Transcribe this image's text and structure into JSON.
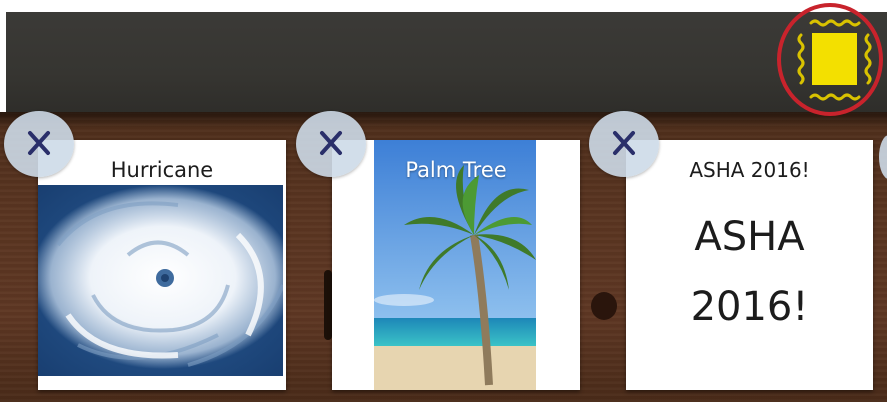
{
  "toolbar": {
    "mode_button_icon": "yellow-square-icon",
    "mode_button_highlight_color": "#c8232c",
    "mode_button_color": "#f3e000"
  },
  "cards": [
    {
      "label": "Hurricane",
      "image": "hurricane-satellite-image",
      "remove_icon": "close-x-icon"
    },
    {
      "label": "Palm Tree",
      "image": "palm-tree-beach-image",
      "remove_icon": "close-x-icon"
    },
    {
      "label": "ASHA 2016!",
      "text_line1": "ASHA",
      "text_line2": "2016!",
      "remove_icon": "close-x-icon"
    }
  ]
}
